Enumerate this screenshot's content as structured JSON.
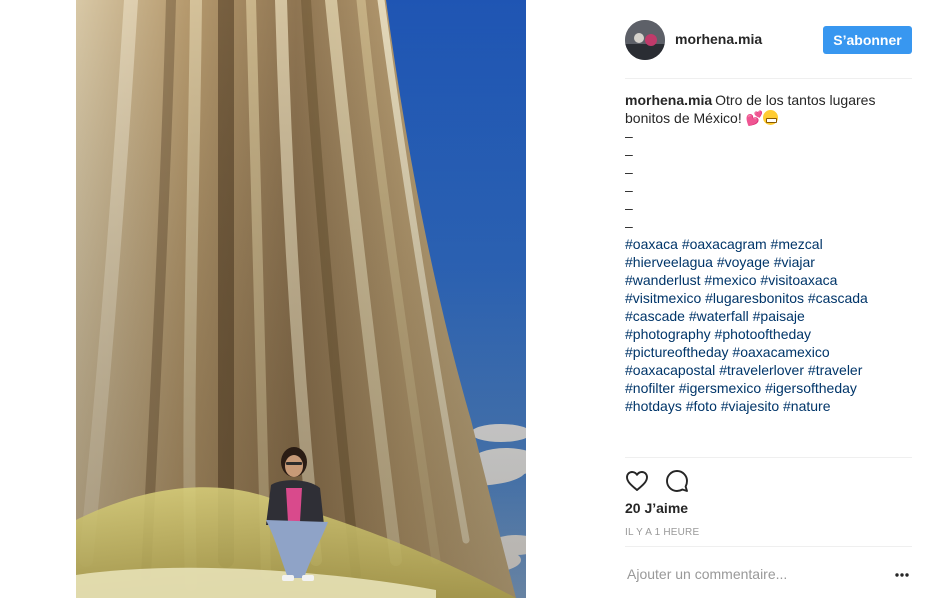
{
  "post": {
    "username": "morhena.mia",
    "follow_label": "S’abonner",
    "caption_text": "Otro de los tantos lugares bonitos de México!",
    "caption_emoji": [
      "heart-emoji",
      "grinning-face-emoji"
    ],
    "caption_dashes": [
      "–",
      "–",
      "–",
      "–",
      "–",
      "–"
    ],
    "hashtags": [
      [
        "#oaxaca",
        "#oaxacagram",
        "#mezcal"
      ],
      [
        "#hierveelagua",
        "#voyage",
        "#viajar"
      ],
      [
        "#wanderlust",
        "#mexico",
        "#visitoaxaca"
      ],
      [
        "#visitmexico",
        "#lugaresbonitos",
        "#cascada"
      ],
      [
        "#cascade",
        "#waterfall",
        "#paisaje"
      ],
      [
        "#photography",
        "#photooftheday"
      ],
      [
        "#pictureoftheday",
        "#oaxacamexico"
      ],
      [
        "#oaxacapostal",
        "#travelerlover",
        "#traveler"
      ],
      [
        "#nofilter",
        "#igersmexico",
        "#igersoftheday"
      ],
      [
        "#hotdays",
        "#foto",
        "#viajesito",
        "#nature"
      ]
    ],
    "likes_label": "20 J’aime",
    "timestamp": "IL Y A 1 HEURE",
    "comment_placeholder": "Ajouter un commentaire...",
    "icons": [
      "heart-icon",
      "comment-bubble-icon",
      "more-options-icon"
    ],
    "colors": {
      "accent": "#3897f0",
      "hashtag": "#003569",
      "muted": "#999999"
    }
  }
}
